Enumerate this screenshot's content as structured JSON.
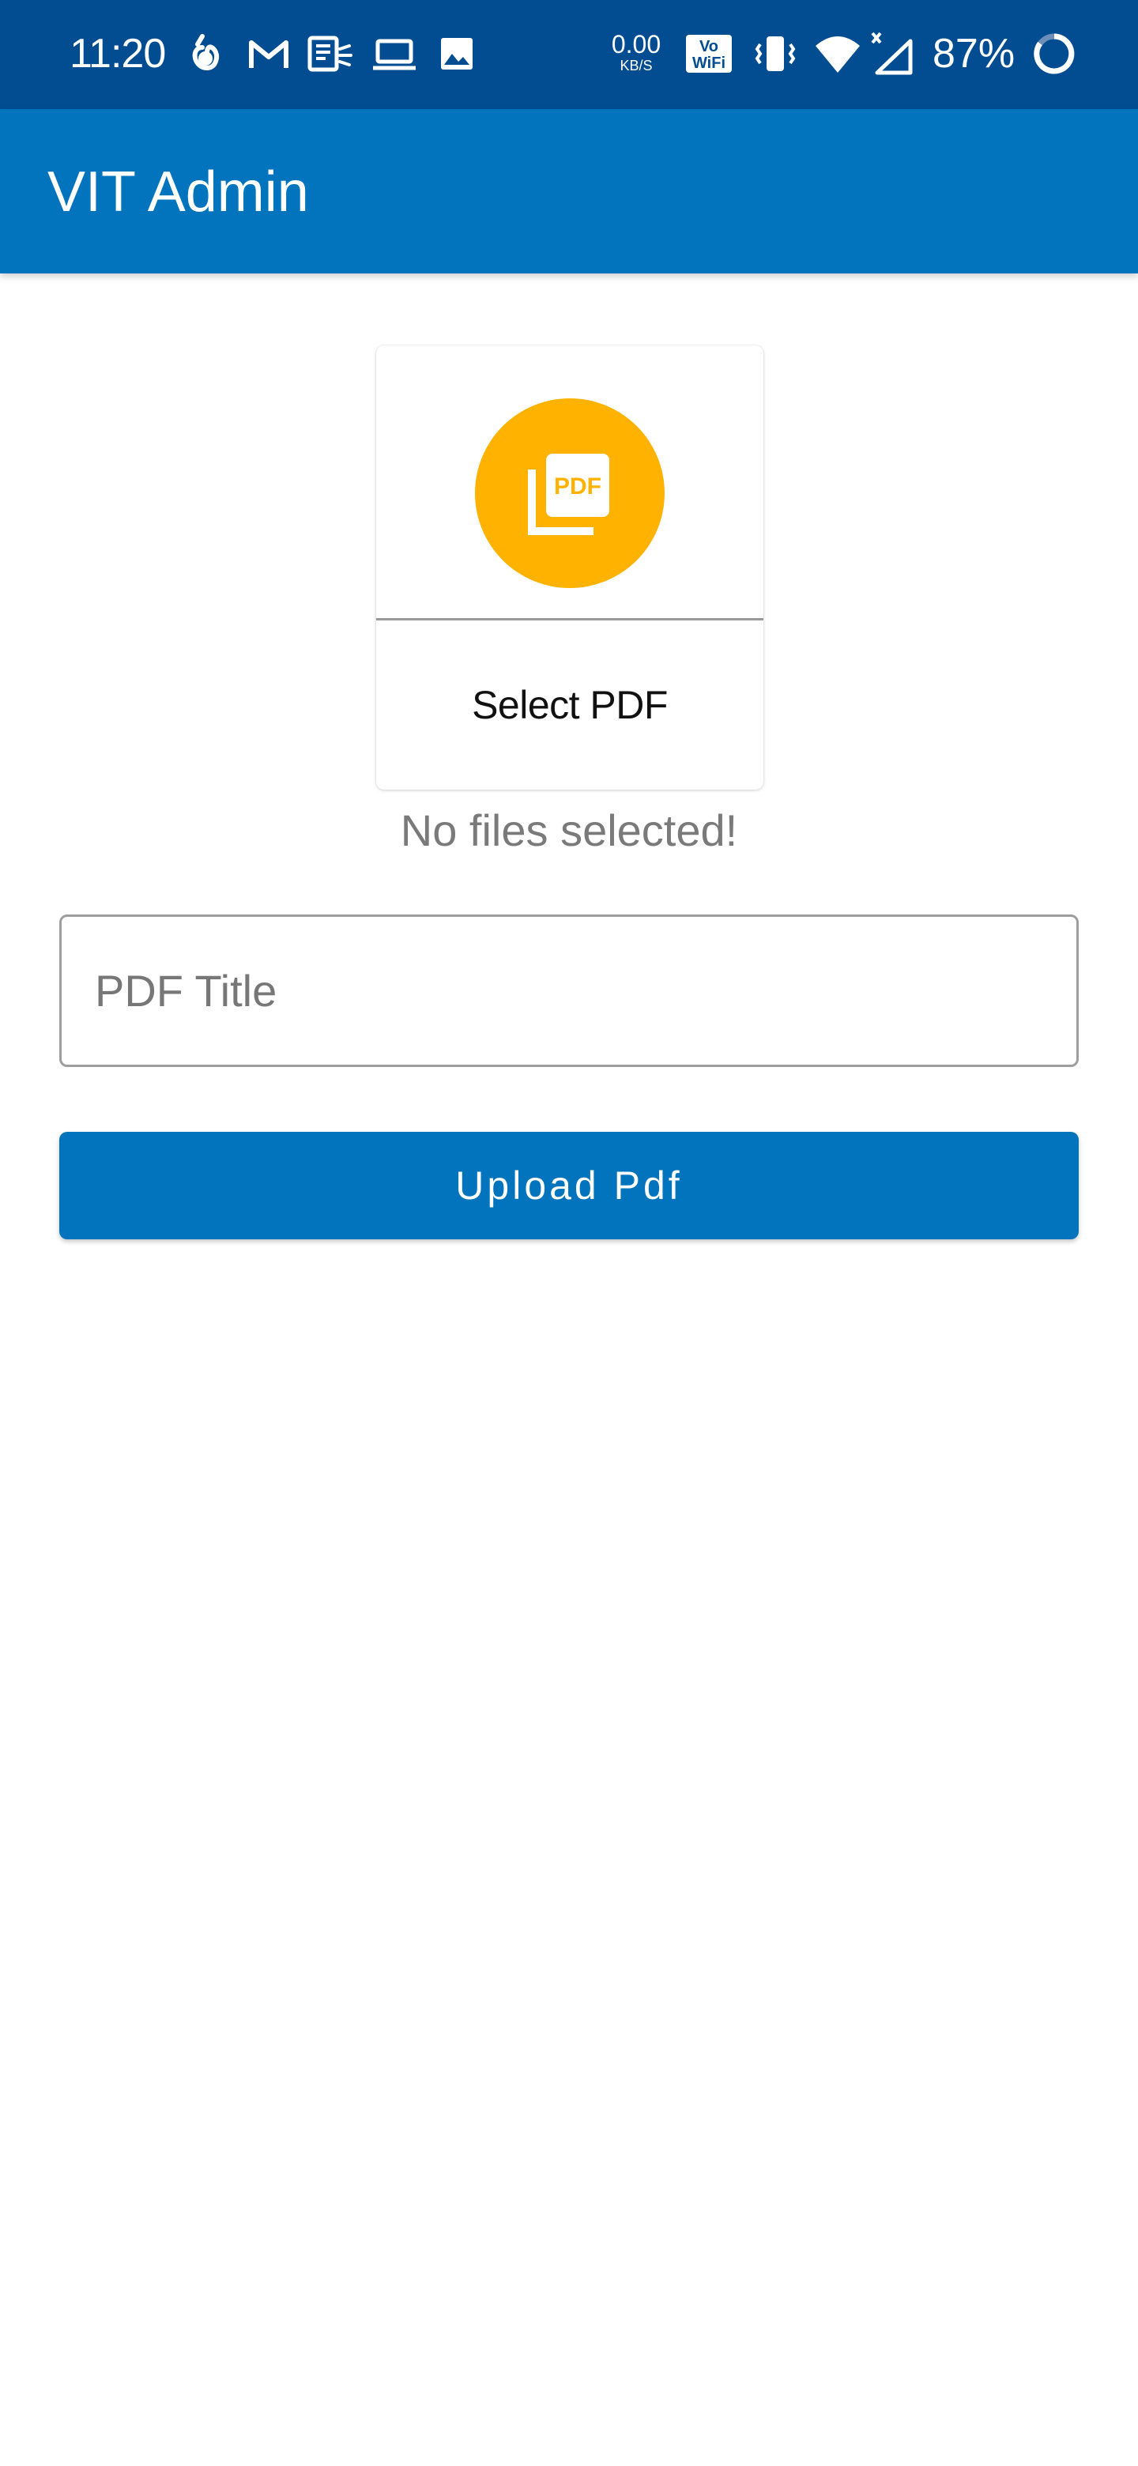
{
  "status_bar": {
    "time": "11:20",
    "net_speed_value": "0.00",
    "net_speed_unit": "KB/S",
    "volte_label": "Vo WiFi",
    "battery_percent": "87%",
    "icons": [
      "hand-ok-icon",
      "gmail-icon",
      "news-icon",
      "laptop-icon",
      "image-icon",
      "vowifi-icon",
      "vibrate-icon",
      "wifi-icon",
      "signal-icon",
      "battery-ring-icon"
    ],
    "background_color": "#024d91"
  },
  "app_bar": {
    "title": "VIT Admin",
    "background_color": "#0274bd"
  },
  "pdf_picker": {
    "badge_color": "#ffb300",
    "badge_text": "PDF",
    "label": "Select PDF",
    "status_text": "No files selected!"
  },
  "form": {
    "title_placeholder": "PDF Title",
    "title_value": "",
    "upload_label": "Upload Pdf",
    "button_color": "#0274bd"
  }
}
